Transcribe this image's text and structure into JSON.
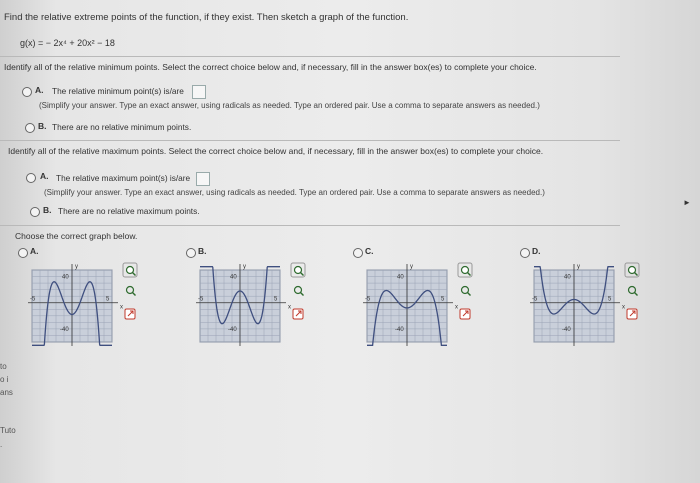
{
  "problem": "Find the relative extreme points of the function, if they exist. Then sketch a graph of the function.",
  "func_html": "g(x) = − 2x⁴ + 20x² − 18",
  "min_section": {
    "instruction": "Identify all of the relative minimum points. Select the correct choice below and, if necessary, fill in the answer box(es) to complete your choice.",
    "choice_a_label": "A.",
    "choice_a_text": "The relative minimum point(s) is/are",
    "choice_a_hint": "(Simplify your answer. Type an exact answer, using radicals as needed. Type an ordered pair. Use a comma to separate answers as needed.)",
    "choice_b_label": "B.",
    "choice_b_text": "There are no relative minimum points."
  },
  "max_section": {
    "instruction": "Identify all of the relative maximum points. Select the correct choice below and, if necessary, fill in the answer box(es) to complete your choice.",
    "choice_a_label": "A.",
    "choice_a_text": "The relative maximum point(s) is/are",
    "choice_a_hint": "(Simplify your answer. Type an exact answer, using radicals as needed. Type an ordered pair. Use a comma to separate answers as needed.)",
    "choice_b_label": "B.",
    "choice_b_text": "There are no relative maximum points."
  },
  "graph_section": {
    "instruction": "Choose the correct graph below.",
    "options": [
      {
        "label": "A.",
        "y_top": "40",
        "y_bot": "-40",
        "x_left": "-5",
        "x_right": "5"
      },
      {
        "label": "B.",
        "y_top": "40",
        "y_bot": "-40",
        "x_left": "-5",
        "x_right": "5"
      },
      {
        "label": "C.",
        "y_top": "40",
        "y_bot": "-40",
        "x_left": "-5",
        "x_right": "5"
      },
      {
        "label": "D.",
        "y_top": "40",
        "y_bot": "-40",
        "x_left": "-5",
        "x_right": "5"
      }
    ],
    "axis_x": "x",
    "axis_y": "y"
  },
  "side_fragments": [
    "to",
    "o i",
    "ans",
    "Tuto",
    "."
  ],
  "icons": [
    "zoom-in-icon",
    "zoom-out-icon",
    "external-link-icon"
  ],
  "colors": {
    "curve": "#3f4f7f",
    "grid": "#9aa3b5",
    "graph_bg": "#c9cfda",
    "zoom_icon": "#2f6b2f",
    "link_icon": "#c0392b"
  }
}
